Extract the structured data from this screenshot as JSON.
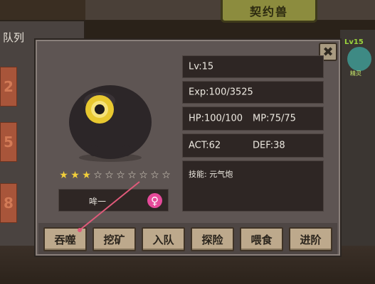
{
  "background": {
    "left_panel_title": "队列",
    "tiles": [
      "2",
      "5",
      "8"
    ],
    "title_banner": "契约兽",
    "side_pet": {
      "level": "Lv15",
      "name": "精灵",
      "color": "#3e8a84"
    }
  },
  "pet": {
    "name": "哞一",
    "stars_total": 10,
    "stars_filled": 3,
    "gender_icon": "female-symbol",
    "gender_glyph": "♀",
    "body_color": "#2c2628",
    "eye_color": "#e8c830"
  },
  "stats": {
    "level": "Lv:15",
    "exp": "Exp:100/3525",
    "hp": "HP:100/100",
    "mp": "MP:75/75",
    "act": "ACT:62",
    "def": "DEF:38",
    "skill": "技能: 元气炮"
  },
  "actions": [
    {
      "id": "devour",
      "label": "吞噬"
    },
    {
      "id": "mine",
      "label": "挖矿"
    },
    {
      "id": "join-team",
      "label": "入队"
    },
    {
      "id": "explore",
      "label": "探险"
    },
    {
      "id": "feed",
      "label": "喂食"
    },
    {
      "id": "evolve",
      "label": "进阶"
    }
  ],
  "close_label": "✖",
  "accent": {
    "star": "#f2cf3a",
    "gender": "#e64a9a",
    "pointer": "#e05a7a"
  }
}
